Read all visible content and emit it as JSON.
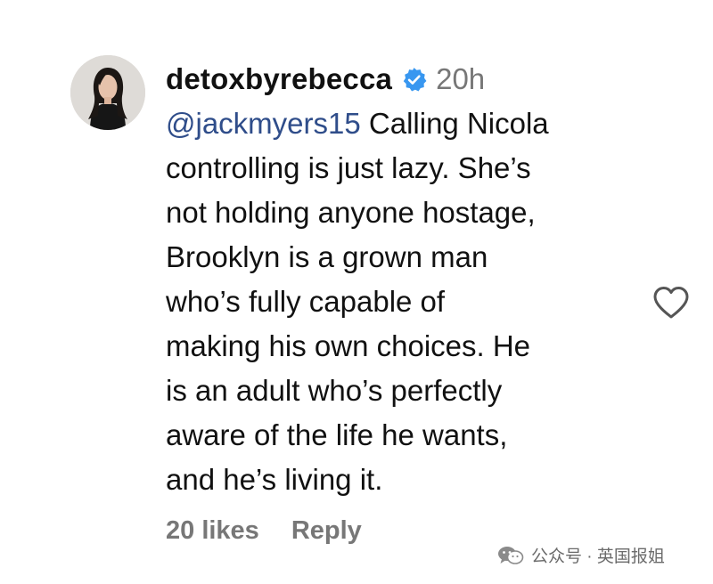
{
  "comment": {
    "username": "detoxbyrebecca",
    "verified": true,
    "timestamp": "20h",
    "mention": "@jackmyers15",
    "text_lines": [
      " Calling Nicola",
      "controlling is just lazy. She’s",
      "not holding anyone hostage,",
      "Brooklyn is a grown man",
      "who’s fully capable of",
      "making his own choices. He",
      "is an adult who’s perfectly",
      "aware of the life he wants,",
      "and he’s living it."
    ],
    "likes_label": "20 likes",
    "reply_label": "Reply"
  },
  "icons": {
    "verified": "verified-badge-icon",
    "like": "heart-outline-icon",
    "watermark": "wechat-logo-icon"
  },
  "watermark": {
    "text": "公众号 · 英国报姐"
  },
  "colors": {
    "verified_badge": "#3897f0",
    "mention": "#2f4d8a",
    "secondary_text": "#777777",
    "primary_text": "#111111"
  }
}
